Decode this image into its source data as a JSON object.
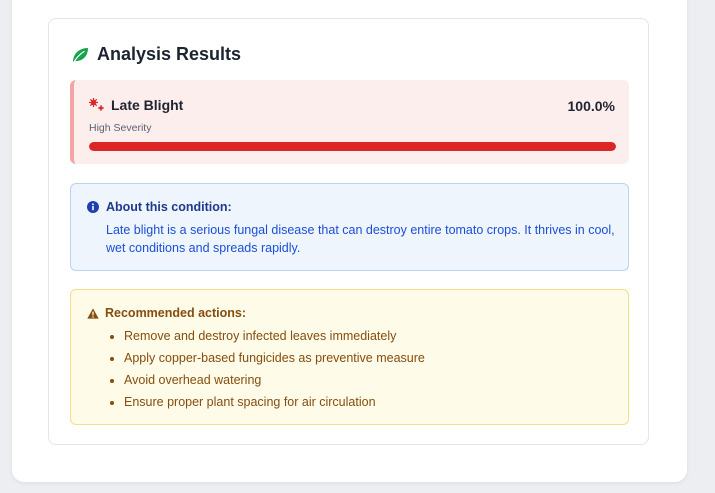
{
  "results": {
    "title": "Analysis Results",
    "title_icon": "leaf-icon"
  },
  "disease": {
    "icon": "virus-icon",
    "name": "Late Blight",
    "confidence_text": "100.0%",
    "confidence": 1.0,
    "severity": "High Severity"
  },
  "about": {
    "icon": "info-icon",
    "title": "About this condition:",
    "text": "Late blight is a serious fungal disease that can destroy entire tomato crops. It thrives in cool, wet conditions and spreads rapidly."
  },
  "actions": {
    "icon": "warning-icon",
    "title": "Recommended actions:",
    "items": [
      "Remove and destroy infected leaves immediately",
      "Apply copper-based fungicides as preventive measure",
      "Avoid overhead watering",
      "Ensure proper plant spacing for air circulation"
    ]
  },
  "colors": {
    "accent_green": "#16a34a",
    "danger_red": "#dc2626",
    "info_blue": "#1e40af",
    "warning_brown": "#854d0e"
  }
}
